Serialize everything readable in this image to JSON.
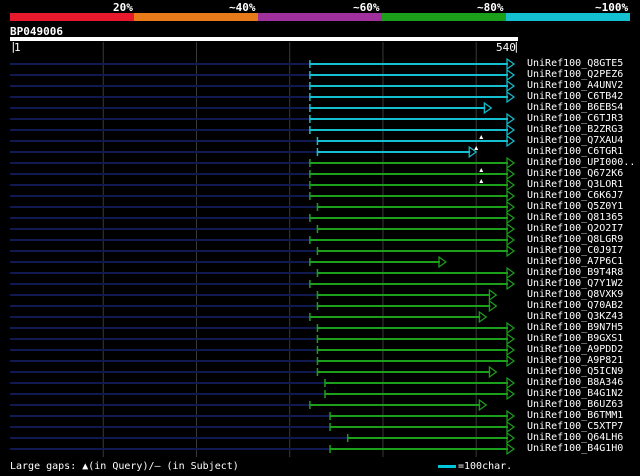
{
  "legend": {
    "labels": [
      "20%",
      "~40%",
      "~60%",
      "~80%",
      "~100%"
    ],
    "colors": [
      "#e8192c",
      "#e87a1a",
      "#a0309c",
      "#1ca01c",
      "#14c0d0"
    ]
  },
  "query": {
    "name": "BP049006",
    "start": "1",
    "end": "540"
  },
  "hits": [
    {
      "name": "UniRef100_Q8GTE5",
      "color": "cyan",
      "start": 0.595,
      "end": 1.0,
      "gaps": []
    },
    {
      "name": "UniRef100_Q2PEZ6",
      "color": "cyan",
      "start": 0.595,
      "end": 1.0,
      "gaps": []
    },
    {
      "name": "UniRef100_A4UNV2",
      "color": "cyan",
      "start": 0.595,
      "end": 1.0,
      "gaps": []
    },
    {
      "name": "UniRef100_C6TB42",
      "color": "cyan",
      "start": 0.595,
      "end": 1.0,
      "gaps": []
    },
    {
      "name": "UniRef100_B6EBS4",
      "color": "cyan",
      "start": 0.595,
      "end": 0.955,
      "gaps": []
    },
    {
      "name": "UniRef100_C6TJR3",
      "color": "cyan",
      "start": 0.595,
      "end": 1.0,
      "gaps": []
    },
    {
      "name": "UniRef100_B2ZRG3",
      "color": "cyan",
      "start": 0.595,
      "end": 1.0,
      "gaps": []
    },
    {
      "name": "UniRef100_Q7XAU4",
      "color": "cyan",
      "start": 0.61,
      "end": 1.0,
      "gaps": [
        0.935
      ]
    },
    {
      "name": "UniRef100_C6TGR1",
      "color": "cyan",
      "start": 0.61,
      "end": 0.925,
      "gaps": [
        0.925
      ]
    },
    {
      "name": "UniRef100_UPI000..",
      "color": "green",
      "start": 0.595,
      "end": 1.0,
      "gaps": []
    },
    {
      "name": "UniRef100_Q672K6",
      "color": "green",
      "start": 0.595,
      "end": 1.0,
      "gaps": [
        0.935
      ]
    },
    {
      "name": "UniRef100_Q3LOR1",
      "color": "green",
      "start": 0.595,
      "end": 1.0,
      "gaps": [
        0.935
      ]
    },
    {
      "name": "UniRef100_C6K6J7",
      "color": "green",
      "start": 0.595,
      "end": 1.0,
      "gaps": []
    },
    {
      "name": "UniRef100_Q5Z0Y1",
      "color": "green",
      "start": 0.61,
      "end": 1.0,
      "gaps": []
    },
    {
      "name": "UniRef100_Q81365",
      "color": "green",
      "start": 0.595,
      "end": 1.0,
      "gaps": []
    },
    {
      "name": "UniRef100_Q2O2I7",
      "color": "green",
      "start": 0.61,
      "end": 1.0,
      "gaps": []
    },
    {
      "name": "UniRef100_Q8LGR9",
      "color": "green",
      "start": 0.595,
      "end": 1.0,
      "gaps": []
    },
    {
      "name": "UniRef100_C0J9I7",
      "color": "green",
      "start": 0.61,
      "end": 1.0,
      "gaps": []
    },
    {
      "name": "UniRef100_A7P6C1",
      "color": "green",
      "start": 0.595,
      "end": 0.865,
      "gaps": []
    },
    {
      "name": "UniRef100_B9T4R8",
      "color": "green",
      "start": 0.61,
      "end": 1.0,
      "gaps": []
    },
    {
      "name": "UniRef100_Q7Y1W2",
      "color": "green",
      "start": 0.595,
      "end": 1.0,
      "gaps": []
    },
    {
      "name": "UniRef100_Q8VXK9",
      "color": "green",
      "start": 0.61,
      "end": 0.965,
      "gaps": []
    },
    {
      "name": "UniRef100_Q70AB2",
      "color": "green",
      "start": 0.61,
      "end": 0.965,
      "gaps": []
    },
    {
      "name": "UniRef100_Q3KZ43",
      "color": "green",
      "start": 0.595,
      "end": 0.945,
      "gaps": []
    },
    {
      "name": "UniRef100_B9N7H5",
      "color": "green",
      "start": 0.61,
      "end": 1.0,
      "gaps": []
    },
    {
      "name": "UniRef100_B9GXS1",
      "color": "green",
      "start": 0.61,
      "end": 1.0,
      "gaps": []
    },
    {
      "name": "UniRef100_A9PDD2",
      "color": "green",
      "start": 0.61,
      "end": 1.0,
      "gaps": []
    },
    {
      "name": "UniRef100_A9P821",
      "color": "green",
      "start": 0.61,
      "end": 1.0,
      "gaps": []
    },
    {
      "name": "UniRef100_Q5ICN9",
      "color": "green",
      "start": 0.61,
      "end": 0.965,
      "gaps": []
    },
    {
      "name": "UniRef100_B8A346",
      "color": "green",
      "start": 0.625,
      "end": 1.0,
      "gaps": []
    },
    {
      "name": "UniRef100_B4G1N2",
      "color": "green",
      "start": 0.625,
      "end": 1.0,
      "gaps": []
    },
    {
      "name": "UniRef100_B6UZ63",
      "color": "green",
      "start": 0.595,
      "end": 0.945,
      "gaps": []
    },
    {
      "name": "UniRef100_B6TMM1",
      "color": "green",
      "start": 0.635,
      "end": 1.0,
      "gaps": []
    },
    {
      "name": "UniRef100_C5XTP7",
      "color": "green",
      "start": 0.635,
      "end": 1.0,
      "gaps": []
    },
    {
      "name": "UniRef100_Q64LH6",
      "color": "green",
      "start": 0.67,
      "end": 1.0,
      "gaps": []
    },
    {
      "name": "UniRef100_B4G1H0",
      "color": "green",
      "start": 0.635,
      "end": 1.0,
      "gaps": []
    }
  ],
  "footer": {
    "large_gaps": "Large gaps: ▲(in Query)/– (in Subject)",
    "scale_note": "=100char."
  }
}
